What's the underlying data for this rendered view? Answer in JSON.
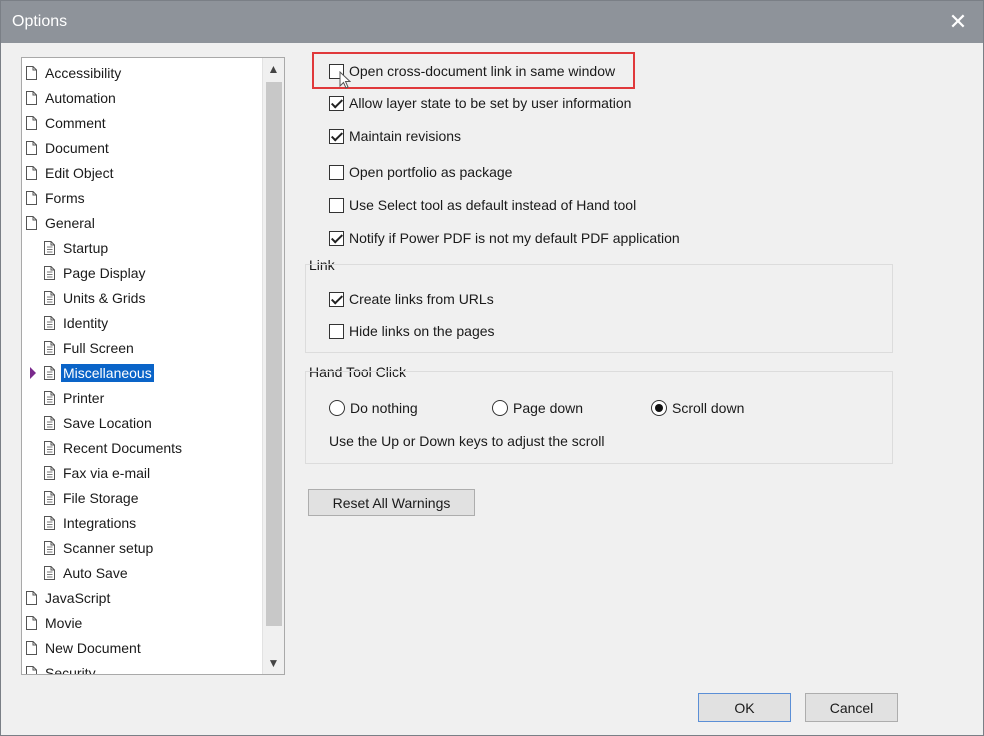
{
  "window": {
    "title": "Options"
  },
  "tree": {
    "items": [
      {
        "label": "Accessibility",
        "level": 0
      },
      {
        "label": "Automation",
        "level": 0
      },
      {
        "label": "Comment",
        "level": 0
      },
      {
        "label": "Document",
        "level": 0
      },
      {
        "label": "Edit Object",
        "level": 0
      },
      {
        "label": "Forms",
        "level": 0
      },
      {
        "label": "General",
        "level": 0
      },
      {
        "label": "Startup",
        "level": 1
      },
      {
        "label": "Page Display",
        "level": 1
      },
      {
        "label": "Units & Grids",
        "level": 1
      },
      {
        "label": "Identity",
        "level": 1
      },
      {
        "label": "Full Screen",
        "level": 1
      },
      {
        "label": "Miscellaneous",
        "level": 1,
        "selected": true
      },
      {
        "label": "Printer",
        "level": 1
      },
      {
        "label": "Save Location",
        "level": 1
      },
      {
        "label": "Recent Documents",
        "level": 1
      },
      {
        "label": "Fax via e-mail",
        "level": 1
      },
      {
        "label": "File Storage",
        "level": 1
      },
      {
        "label": "Integrations",
        "level": 1
      },
      {
        "label": "Scanner setup",
        "level": 1
      },
      {
        "label": "Auto Save",
        "level": 1
      },
      {
        "label": "JavaScript",
        "level": 0
      },
      {
        "label": "Movie",
        "level": 0
      },
      {
        "label": "New Document",
        "level": 0
      },
      {
        "label": "Security",
        "level": 0
      }
    ]
  },
  "general_options": [
    {
      "label": "Open cross-document link in same window",
      "checked": false
    },
    {
      "label": "Allow layer state to be set by user information",
      "checked": true
    },
    {
      "label": "Maintain revisions",
      "checked": true
    },
    {
      "label": "Open portfolio as package",
      "checked": false
    },
    {
      "label": "Use Select tool as default instead of Hand tool",
      "checked": false
    },
    {
      "label": "Notify if Power PDF is not my default PDF application",
      "checked": true
    }
  ],
  "link_group": {
    "title": "Link",
    "options": [
      {
        "label": "Create links from URLs",
        "checked": true
      },
      {
        "label": "Hide links on the pages",
        "checked": false
      }
    ]
  },
  "hand_tool_group": {
    "title": "Hand Tool Click",
    "options": [
      {
        "label": "Do nothing",
        "selected": false
      },
      {
        "label": "Page down",
        "selected": false
      },
      {
        "label": "Scroll down",
        "selected": true
      }
    ],
    "hint": "Use the Up or Down keys to adjust the scroll"
  },
  "buttons": {
    "reset": "Reset All Warnings",
    "ok": "OK",
    "cancel": "Cancel"
  },
  "colors": {
    "selection": "#0a64c8",
    "highlight_border": "#e0393b",
    "titlebar": "#8e939a"
  }
}
